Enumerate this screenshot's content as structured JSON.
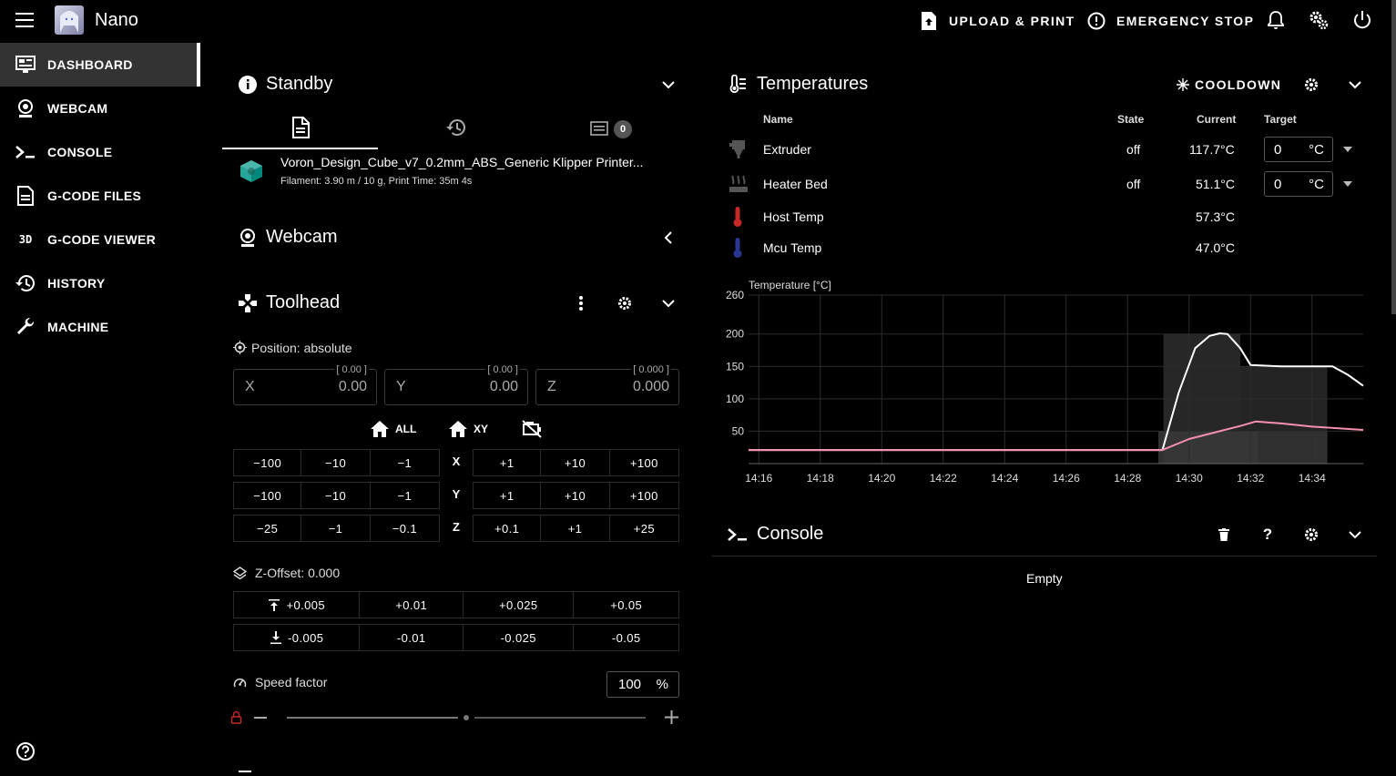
{
  "app": {
    "title": "Nano"
  },
  "appbar": {
    "upload_label": "UPLOAD & PRINT",
    "estop_label": "EMERGENCY STOP"
  },
  "sidebar": {
    "items": [
      {
        "label": "DASHBOARD",
        "icon": "monitor-dashboard-icon"
      },
      {
        "label": "WEBCAM",
        "icon": "webcam-icon"
      },
      {
        "label": "CONSOLE",
        "icon": "console-icon"
      },
      {
        "label": "G-CODE FILES",
        "icon": "file-document-icon"
      },
      {
        "label": "G-CODE VIEWER",
        "icon": "3d-icon"
      },
      {
        "label": "HISTORY",
        "icon": "history-icon"
      },
      {
        "label": "MACHINE",
        "icon": "wrench-icon"
      }
    ]
  },
  "status": {
    "title": "Standby",
    "jobs_badge": "0",
    "file": {
      "name": "Voron_Design_Cube_v7_0.2mm_ABS_Generic Klipper Printer...",
      "details": "Filament: 3.90 m / 10 g, Print Time: 35m 4s"
    }
  },
  "webcam": {
    "title": "Webcam"
  },
  "toolhead": {
    "title": "Toolhead",
    "position_mode": "Position: absolute",
    "fields": [
      {
        "label": "X",
        "value": "0.00",
        "current": "[ 0.00 ]"
      },
      {
        "label": "Y",
        "value": "0.00",
        "current": "[ 0.00 ]"
      },
      {
        "label": "Z",
        "value": "0.000",
        "current": "[ 0.000 ]"
      }
    ],
    "home_all": "ALL",
    "home_xy": "XY",
    "rows": [
      {
        "axis": "X",
        "neg": [
          "−100",
          "−10",
          "−1"
        ],
        "pos": [
          "+1",
          "+10",
          "+100"
        ]
      },
      {
        "axis": "Y",
        "neg": [
          "−100",
          "−10",
          "−1"
        ],
        "pos": [
          "+1",
          "+10",
          "+100"
        ]
      },
      {
        "axis": "Z",
        "neg": [
          "−25",
          "−1",
          "−0.1"
        ],
        "pos": [
          "+0.1",
          "+1",
          "+25"
        ]
      }
    ],
    "zoffset_label": "Z-Offset: 0.000",
    "zoffset_up": [
      "+0.005",
      "+0.01",
      "+0.025",
      "+0.05"
    ],
    "zoffset_down": [
      "-0.005",
      "-0.01",
      "-0.025",
      "-0.05"
    ],
    "speed_label": "Speed factor",
    "speed_value": "100",
    "speed_unit": "%",
    "speed_slider_fraction": 0.5
  },
  "temperatures": {
    "title": "Temperatures",
    "cooldown_label": "COOLDOWN",
    "headers": {
      "name": "Name",
      "state": "State",
      "current": "Current",
      "target": "Target"
    },
    "rows": [
      {
        "name": "Extruder",
        "state": "off",
        "current": "117.7°C",
        "target": "0",
        "unit": "°C",
        "icon": "extruder-icon",
        "icon_color": "#666666"
      },
      {
        "name": "Heater Bed",
        "state": "off",
        "current": "51.1°C",
        "target": "0",
        "unit": "°C",
        "icon": "heater-bed-icon",
        "icon_color": "#555555"
      },
      {
        "name": "Host Temp",
        "state": "",
        "current": "57.3°C",
        "target": "",
        "unit": "",
        "icon": "thermometer-icon",
        "icon_color": "#c62828"
      },
      {
        "name": "Mcu Temp",
        "state": "",
        "current": "47.0°C",
        "target": "",
        "unit": "",
        "icon": "thermometer-icon",
        "icon_color": "#283593"
      }
    ]
  },
  "chart_data": {
    "type": "line",
    "ylabel": "Temperature [°C]",
    "ylim": [
      0,
      260
    ],
    "yticks": [
      50,
      100,
      150,
      200,
      260
    ],
    "xticks": [
      "14:16",
      "14:18",
      "14:20",
      "14:22",
      "14:24",
      "14:26",
      "14:28",
      "14:30",
      "14:32",
      "14:34"
    ],
    "x_minutes_range": [
      "14:15:40",
      "14:35:40"
    ],
    "grid": true,
    "series": [
      {
        "color": "#ffffff",
        "points": [
          [
            "14:15:40",
            21
          ],
          [
            "14:29:08",
            21
          ],
          [
            "14:29:40",
            110
          ],
          [
            "14:30:12",
            178
          ],
          [
            "14:30:40",
            197
          ],
          [
            "14:31:00",
            201
          ],
          [
            "14:31:15",
            200
          ],
          [
            "14:31:40",
            178
          ],
          [
            "14:32:00",
            152
          ],
          [
            "14:33:00",
            150
          ],
          [
            "14:34:40",
            150
          ],
          [
            "14:35:10",
            137
          ],
          [
            "14:35:40",
            120
          ]
        ]
      },
      {
        "color": "#f48fb1",
        "points": [
          [
            "14:15:40",
            21
          ],
          [
            "14:29:08",
            21
          ],
          [
            "14:30:00",
            38
          ],
          [
            "14:31:00",
            50
          ],
          [
            "14:31:40",
            58
          ],
          [
            "14:32:10",
            65
          ],
          [
            "14:33:00",
            62
          ],
          [
            "14:34:00",
            57
          ],
          [
            "14:35:40",
            52
          ]
        ]
      }
    ],
    "target_bands": [
      {
        "from": "14:29:10",
        "to": "14:31:40",
        "value": 200,
        "color": "#2e2e2e"
      },
      {
        "from": "14:31:40",
        "to": "14:34:30",
        "value": 150,
        "color": "#2a2a2a"
      },
      {
        "from": "14:29:00",
        "to": "14:32:15",
        "value": 50,
        "color": "#3a3a3a"
      },
      {
        "from": "14:32:15",
        "to": "14:34:30",
        "value": 50,
        "color": "#333333"
      }
    ]
  },
  "console": {
    "title": "Console",
    "empty_label": "Empty"
  },
  "colors": {
    "active_nav_bg": "#333333",
    "accent": "#ffffff",
    "chart_line_extruder": "#ffffff",
    "chart_line_bed": "#f48fb1"
  }
}
